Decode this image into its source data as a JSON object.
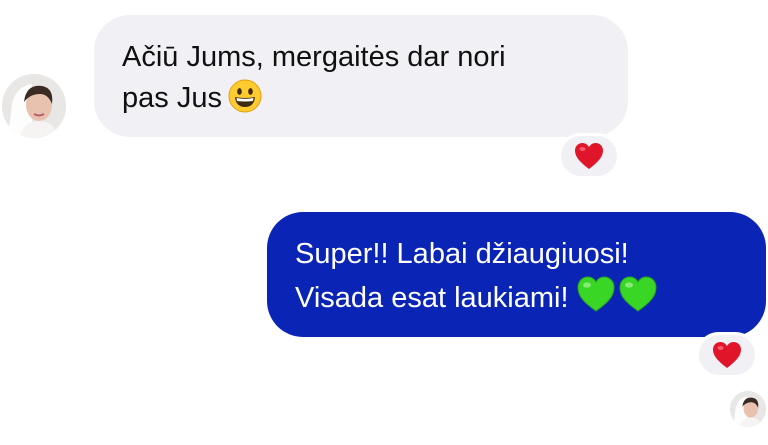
{
  "conversation": {
    "incoming_message": {
      "line1": "Ačiū Jums, mergaitės dar nori",
      "line2": "pas Jus",
      "emoji": "grinning-face-emoji",
      "reaction": "red-heart-icon"
    },
    "outgoing_message": {
      "line1": "Super!! Labai džiaugiuosi!",
      "line2": "Visada esat laukiami!",
      "emoji": "green-heart-emoji",
      "reaction": "red-heart-icon"
    }
  },
  "colors": {
    "incoming_bubble": "#f0f0f5",
    "outgoing_bubble": "#0a24b6",
    "heart_red": "#e0152a",
    "heart_green": "#39d626"
  }
}
